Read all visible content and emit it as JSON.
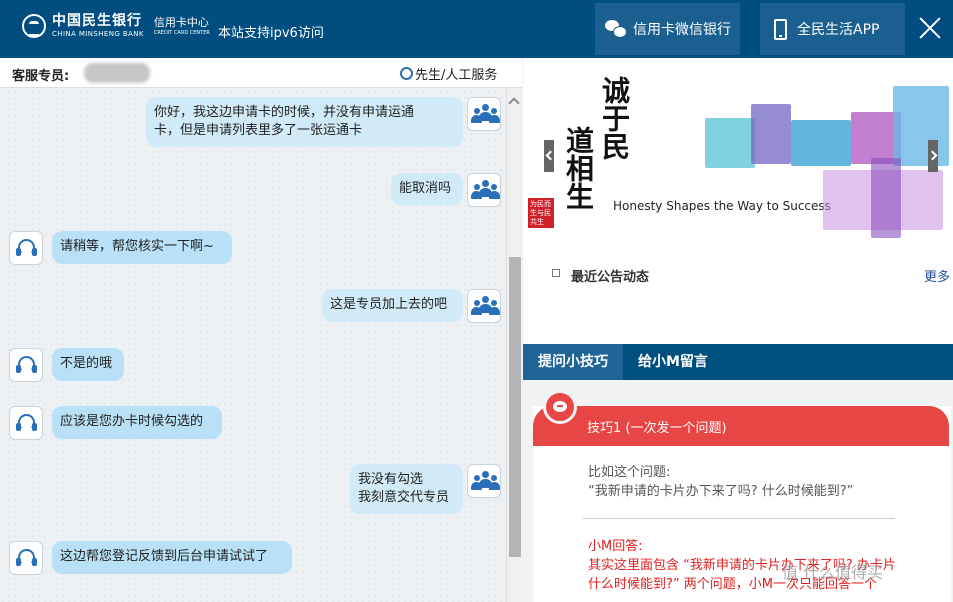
{
  "header": {
    "bank_name_cn": "中国民生银行",
    "bank_name_en": "CHINA MINSHENG BANK",
    "center_cn": "信用卡中心",
    "center_en": "CREDIT CARD CENTER",
    "ipv6_notice": "本站支持ipv6访问",
    "wechat_button": "信用卡微信银行",
    "app_button": "全民生活APP",
    "close_icon": "close-icon"
  },
  "chat": {
    "agent_label": "客服专员:",
    "human_service": "先生/人工服务",
    "messages": [
      {
        "from": "user",
        "text": "你好，我这边申请卡的时候，并没有申请运通\n卡，但是申请列表里多了一张运通卡"
      },
      {
        "from": "user",
        "text": "能取消吗"
      },
      {
        "from": "agent",
        "text": "请稍等，帮您核实一下啊~"
      },
      {
        "from": "user",
        "text": "这是专员加上去的吧"
      },
      {
        "from": "agent",
        "text": "不是的哦"
      },
      {
        "from": "agent",
        "text": "应该是您办卡时候勾选的"
      },
      {
        "from": "user",
        "text": "我没有勾选\n我刻意交代专员"
      },
      {
        "from": "agent",
        "text": "这边帮您登记反馈到后台申请试试了"
      }
    ]
  },
  "banner": {
    "calligraphy_1": "诚于民",
    "calligraphy_2": "道相生",
    "stamp": "为民而生与民共生",
    "slogan": "Honesty Shapes the Way to Success"
  },
  "notice": {
    "title": "最近公告动态",
    "more": "更多"
  },
  "tabs": {
    "tab1": "提问小技巧",
    "tab2": "给小M留言"
  },
  "tips": {
    "tip_title": "技巧1 (一次发一个问题)",
    "example_label": "比如这个问题:",
    "example_question": "“我新申请的卡片办下来了吗? 什么时候能到?”",
    "answer_label": "小M回答:",
    "answer_line1": "其实这里面包含 “我新申请的卡片办下来了吗? 办卡片",
    "answer_line2": "什么时候能到?” 两个问题，小M一次只能回答一个"
  },
  "watermark": "值 什么值得买",
  "colors": {
    "header_bg": "#004d80",
    "tab_bg": "#00507f",
    "tip_red": "#e84545",
    "bubble_blue": "#b8e0f6"
  }
}
